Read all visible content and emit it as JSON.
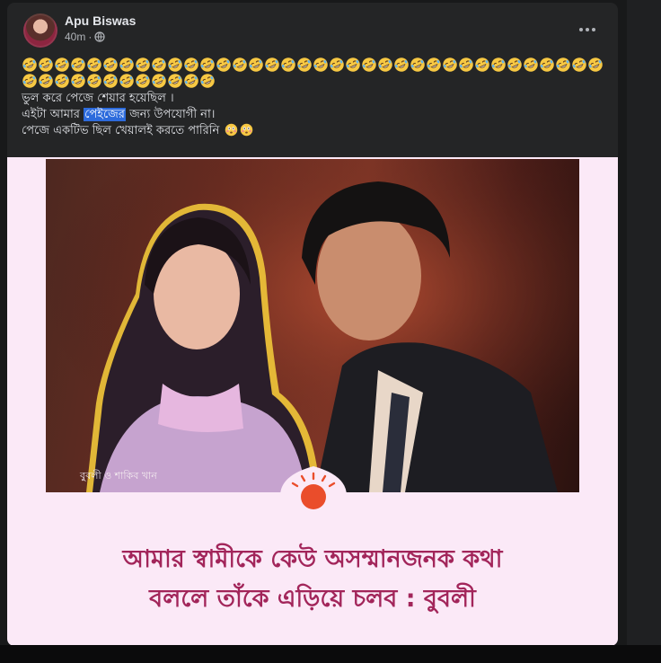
{
  "post": {
    "author": "Apu Biswas",
    "time": "40m",
    "separator": "·",
    "privacy_icon": "globe-icon",
    "more_icon": "more-dots-icon",
    "emoji_row1_count": 36,
    "emoji_row2_count": 12,
    "emoji_name": "rolling-on-floor-laughing-emoji",
    "text_line1": "ভুল করে পেজে শেয়ার হয়েছিল ।",
    "text_line2_pre": "এইটা আমার ",
    "text_line2_highlight": "পেইজের",
    "text_line2_post": " জন্য উপযোগী না।",
    "text_line3": "পেজে একটিভ ছিল খেয়ালই করতে পারিনি",
    "text_line3_emoji": "flushed-emoji"
  },
  "shared_image": {
    "photo_caption": "বুবলী ও শাকিব খান",
    "headline_line1": "আমার স্বামীকে কেউ অসম্মানজনক কথা",
    "headline_line2": "বললে তাঁকে এড়িয়ে চলব : বুবলী",
    "badge_icon": "sun-logo-icon",
    "headline_color": "#a2255a",
    "background_color": "#fbe9f7"
  },
  "colors": {
    "page_bg": "#18191a",
    "card_bg": "#242526",
    "primary_text": "#e4e6eb",
    "secondary_text": "#b0b3b8",
    "highlight": "#2d6bdc"
  }
}
